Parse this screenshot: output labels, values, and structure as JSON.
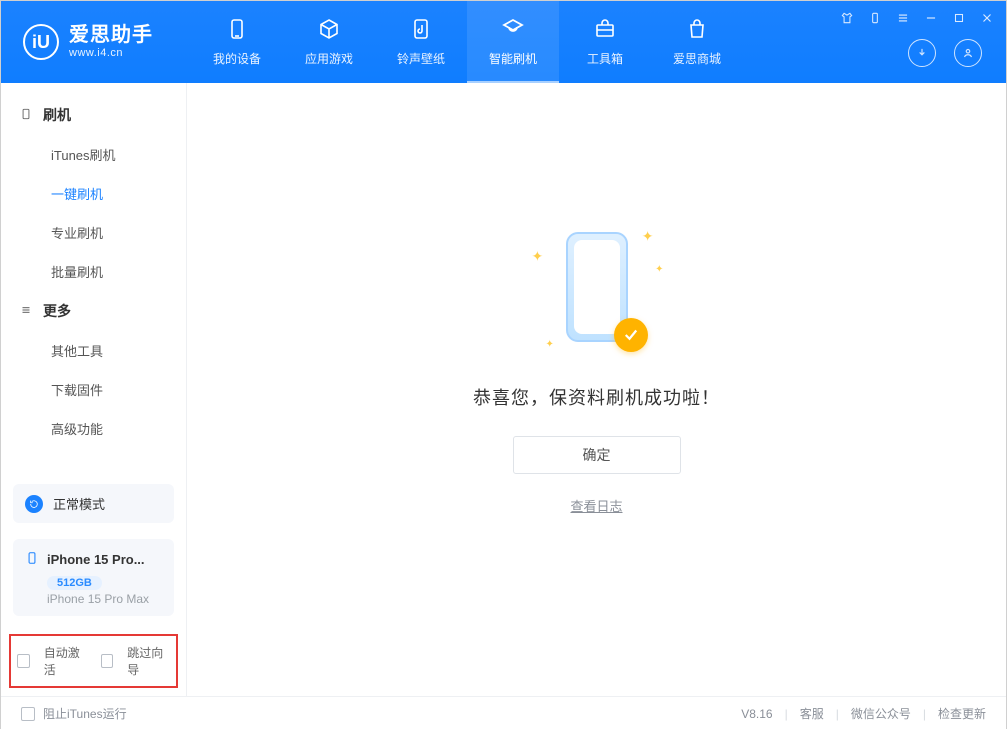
{
  "brand": {
    "logo_text": "iU",
    "title": "爱思助手",
    "subtitle": "www.i4.cn"
  },
  "nav": [
    {
      "label": "我的设备",
      "icon": "phone"
    },
    {
      "label": "应用游戏",
      "icon": "cube"
    },
    {
      "label": "铃声壁纸",
      "icon": "music"
    },
    {
      "label": "智能刷机",
      "icon": "refresh",
      "active": true
    },
    {
      "label": "工具箱",
      "icon": "toolbox"
    },
    {
      "label": "爱思商城",
      "icon": "bag"
    }
  ],
  "sidebar": {
    "group1_title": "刷机",
    "group1_items": [
      "iTunes刷机",
      "一键刷机",
      "专业刷机",
      "批量刷机"
    ],
    "group1_active_index": 1,
    "group2_title": "更多",
    "group2_items": [
      "其他工具",
      "下载固件",
      "高级功能"
    ]
  },
  "mode": {
    "label": "正常模式"
  },
  "device": {
    "name_short": "iPhone 15 Pro...",
    "storage": "512GB",
    "full_name": "iPhone 15 Pro Max"
  },
  "checkboxes": {
    "auto_activate": "自动激活",
    "skip_wizard": "跳过向导"
  },
  "main": {
    "success_text": "恭喜您，保资料刷机成功啦！",
    "ok_label": "确定",
    "view_log": "查看日志"
  },
  "footer": {
    "block_itunes": "阻止iTunes运行",
    "version": "V8.16",
    "links": [
      "客服",
      "微信公众号",
      "检查更新"
    ]
  }
}
